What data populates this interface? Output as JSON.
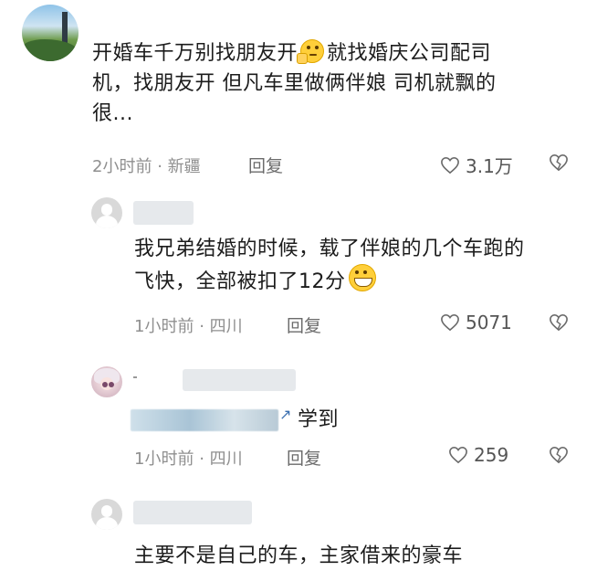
{
  "comments": [
    {
      "text_line1": "开婚车千万别找朋友开",
      "text_line1b": "就找婚庆公司配司",
      "text_line2": "机，找朋友开 但凡车里做俩伴娘 司机就飘的",
      "text_line3": "很...",
      "time": "2小时前",
      "location": "新疆",
      "reply_label": "回复",
      "likes": "3.1万"
    },
    {
      "text_line1": "我兄弟结婚的时候，载了伴娘的几个车跑的",
      "text_line2": "飞快，全部被扣了12分",
      "time": "1小时前",
      "location": "四川",
      "reply_label": "回复",
      "likes": "5071"
    },
    {
      "text": "学到",
      "time": "1小时前",
      "location": "四川",
      "reply_label": "回复",
      "likes": "259"
    },
    {
      "text_partial": "主要不是自己的车，主家借来的豪车"
    }
  ],
  "meta_separator": "·",
  "icons": [
    "heart-icon",
    "dislike-icon",
    "thinking-emoji",
    "grin-emoji",
    "default-avatar-icon"
  ]
}
